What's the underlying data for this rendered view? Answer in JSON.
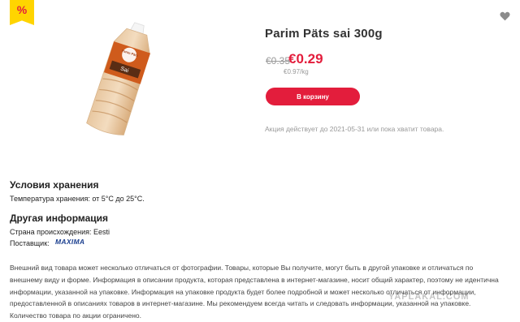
{
  "badge": {
    "symbol": "%"
  },
  "icons": {
    "favorite": "heart-icon"
  },
  "product": {
    "title": "Parim Päts sai 300g",
    "old_price": "€0.35",
    "new_price": "€0.29",
    "unit_price": "€0.97/kg",
    "cart_label": "В корзину",
    "promo_note": "Акция действует до 2021-05-31 или пока хватит товара.",
    "image": {
      "package_brand": "Parim Päts",
      "package_label": "Sai"
    }
  },
  "storage": {
    "heading": "Условия хранения",
    "temperature": "Температура хранения: от 5°C до 25°C."
  },
  "other": {
    "heading": "Другая информация",
    "country": "Страна происхождения: Eesti",
    "supplier_label": "Поставщик:",
    "supplier_logo": "MAXIMA"
  },
  "disclaimer": "Внешний вид товара может несколько отличаться от фотографии. Товары, которые Вы получите, могут быть в другой упаковке и отличаться по внешнему виду и форме. Информация в описании продукта, которая представлена в интернет-магазине, носит общий характер, поэтому не идентична информации, указанной на упаковке. Информация на упаковке продукта будет более подробной и может несколько отличаться от информации, предоставленной в описаниях товаров в интернет-магазине. Мы рекомендуем всегда читать и следовать информации, указанной на упаковке. Количество товара по акции ограничено.",
  "watermark": "YAPLAKAL.COM",
  "colors": {
    "accent": "#e31d3c",
    "badge": "#ffd400",
    "muted": "#999999",
    "logo": "#1b3f8f"
  }
}
